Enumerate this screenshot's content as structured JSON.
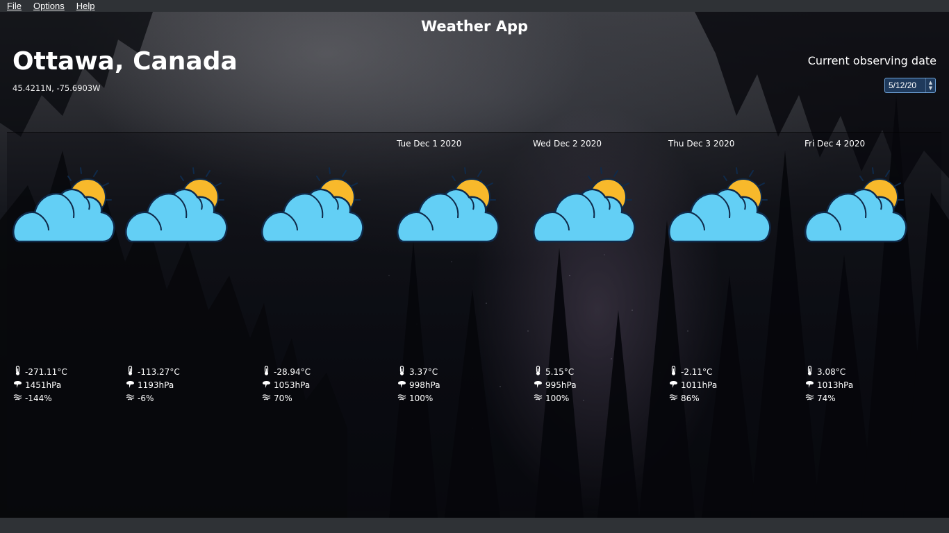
{
  "menu": [
    {
      "label": "File"
    },
    {
      "label": "Options"
    },
    {
      "label": "Help"
    }
  ],
  "app_title": "Weather App",
  "location": {
    "city": "Ottawa, Canada",
    "coords": "45.4211N, -75.6903W"
  },
  "observing": {
    "label": "Current observing date",
    "value": "5/12/20"
  },
  "days": [
    {
      "date": "",
      "icon": "partly-cloudy-icon",
      "temp": "-271.11°C",
      "pressure": "1451hPa",
      "humidity": "-144%"
    },
    {
      "date": "",
      "icon": "partly-cloudy-icon",
      "temp": "-113.27°C",
      "pressure": "1193hPa",
      "humidity": "-6%"
    },
    {
      "date": "",
      "icon": "partly-cloudy-icon",
      "temp": "-28.94°C",
      "pressure": "1053hPa",
      "humidity": "70%"
    },
    {
      "date": "Tue Dec 1 2020",
      "icon": "partly-cloudy-icon",
      "temp": "3.37°C",
      "pressure": "998hPa",
      "humidity": "100%"
    },
    {
      "date": "Wed Dec 2 2020",
      "icon": "partly-cloudy-icon",
      "temp": "5.15°C",
      "pressure": "995hPa",
      "humidity": "100%"
    },
    {
      "date": "Thu Dec 3 2020",
      "icon": "partly-cloudy-icon",
      "temp": "-2.11°C",
      "pressure": "1011hPa",
      "humidity": "86%"
    },
    {
      "date": "Fri Dec 4 2020",
      "icon": "partly-cloudy-icon",
      "temp": "3.08°C",
      "pressure": "1013hPa",
      "humidity": "74%"
    }
  ],
  "colors": {
    "cloud": "#63cff5",
    "cloud_outline": "#0f2a4a",
    "sun": "#f8b92b",
    "menubar": "#2f3236",
    "date_field": "#1f3a5c"
  }
}
